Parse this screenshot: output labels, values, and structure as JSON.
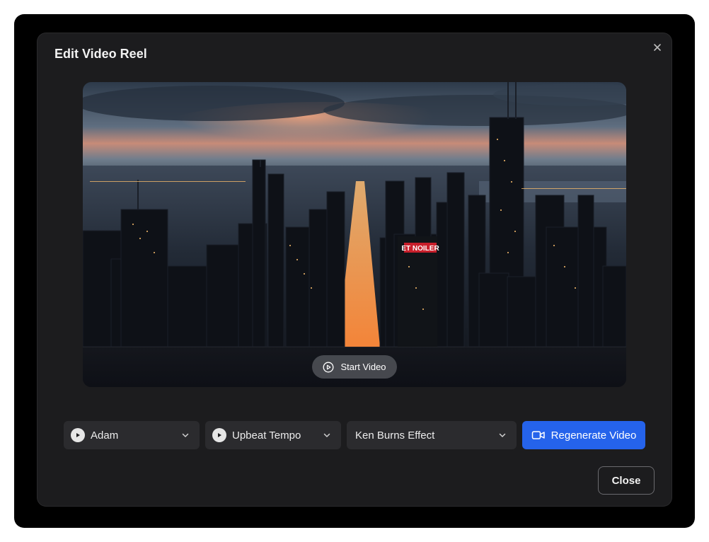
{
  "dialog": {
    "title": "Edit Video Reel",
    "close_icon": "close-icon"
  },
  "video": {
    "billboard_text": "ET NOILER",
    "start_label": "Start Video",
    "start_icon": "play-circle-icon"
  },
  "controls": {
    "voice": {
      "value": "Adam",
      "icon": "play-icon"
    },
    "music": {
      "value": "Upbeat Tempo",
      "icon": "play-icon"
    },
    "effect": {
      "value": "Ken Burns Effect"
    },
    "regenerate_label": "Regenerate Video",
    "regenerate_icon": "video-camera-icon"
  },
  "footer": {
    "close_label": "Close"
  },
  "colors": {
    "accent": "#2563eb",
    "dialog_bg": "#1c1c1e",
    "select_bg": "#2b2b2e"
  }
}
